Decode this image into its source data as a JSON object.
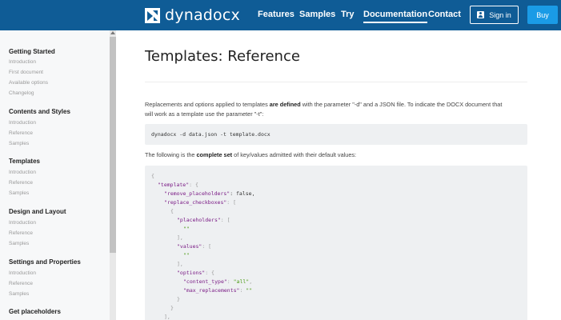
{
  "header": {
    "brand": "dynadocx",
    "nav": [
      {
        "label": "Features",
        "active": false
      },
      {
        "label": "Samples",
        "active": false
      },
      {
        "label": "Try",
        "active": false
      },
      {
        "label": "Documentation",
        "active": true
      },
      {
        "label": "Contact",
        "active": false
      }
    ],
    "signin_label": "Sign in",
    "buy_label": "Buy",
    "colors": {
      "bar": "#0f5c96",
      "buy": "#1a9be6"
    }
  },
  "sidebar": {
    "sections": [
      {
        "title": "Getting Started",
        "items": [
          "Introduction",
          "First document",
          "Available options",
          "Changelog"
        ]
      },
      {
        "title": "Contents and Styles",
        "items": [
          "Introduction",
          "Reference",
          "Samples"
        ]
      },
      {
        "title": "Templates",
        "items": [
          "Introduction",
          "Reference",
          "Samples"
        ]
      },
      {
        "title": "Design and Layout",
        "items": [
          "Introduction",
          "Reference",
          "Samples"
        ]
      },
      {
        "title": "Settings and Properties",
        "items": [
          "Introduction",
          "Reference",
          "Samples"
        ]
      },
      {
        "title": "Get placeholders",
        "items": []
      }
    ]
  },
  "main": {
    "title": "Templates: Reference",
    "intro_pre": "Replacements and options applied to templates ",
    "intro_bold": "are defined",
    "intro_post1": " with the parameter \"-d\" and a JSON file. To indicate the DOCX document that",
    "intro_post2": "will work as a template use the parameter \"-t\":",
    "command": "dynadocx -d data.json -t template.docx",
    "set_pre": "The following is the ",
    "set_bold": "complete set",
    "set_post": " of key/values admitted with their default values:",
    "json_code": {
      "open_brace": "{",
      "template_key": "\"template\"",
      "colon_brace": ": {",
      "remove_key": "\"remove_placeholders\"",
      "remove_val": ": false,",
      "replace_key": "\"replace_checkboxes\"",
      "colon_bracket": ": [",
      "inner_open": "{",
      "placeholders_key": "\"placeholders\"",
      "empty_str": "\"\"",
      "close_bracket_comma": "],",
      "values_key": "\"values\"",
      "options_key": "\"options\"",
      "content_type_key": "\"content_type\"",
      "content_type_val": "\"all\"",
      "comma": ",",
      "max_repl_key": "\"max_replacements\"",
      "colon": ": ",
      "close_brace": "}",
      "close_bracket_comma2": "],"
    }
  }
}
